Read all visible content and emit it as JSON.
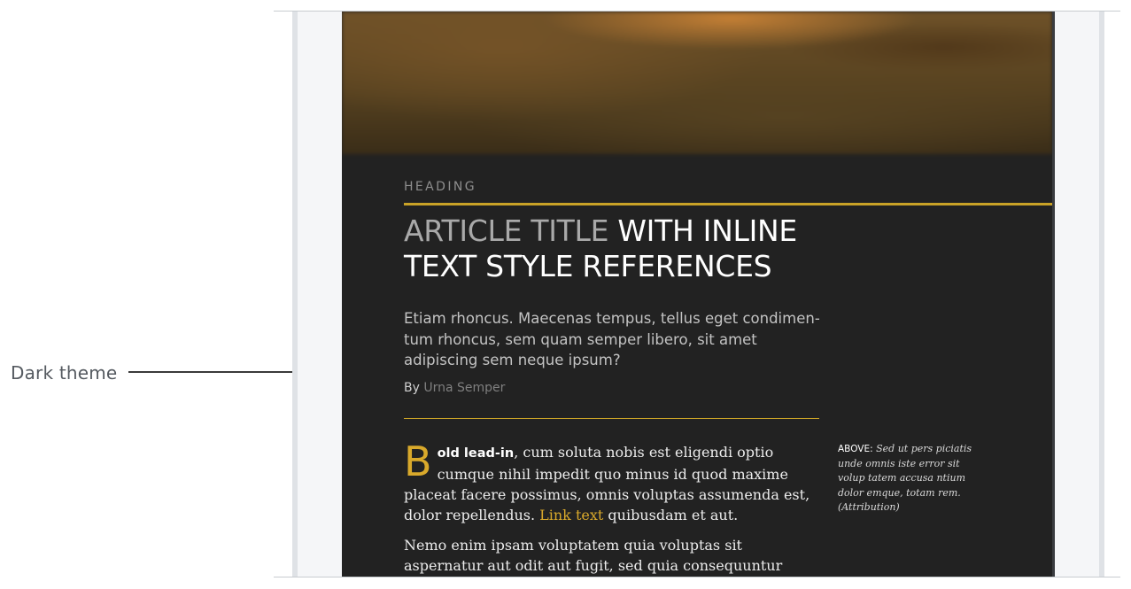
{
  "callout": {
    "label": "Dark theme"
  },
  "article": {
    "heading": "HEADING",
    "title_dim": "ARTICLE TITLE",
    "title_rest": " WITH INLINE TEXT STYLE REFERENCES",
    "deck": "Etiam rhoncus. Maecenas tempus, tellus eget condimen-tum rhoncus, sem quam semper libero, sit amet adipiscing sem neque ipsum?",
    "byline_prefix": "By ",
    "author": "Urna Semper",
    "dropcap": "B",
    "lead_in": "old lead-in",
    "para1_rest": ", cum soluta nobis est eligendi optio cumque nihil impedit quo minus id quod maxime placeat facere possimus, omnis voluptas assumenda est, dolor repellendus. ",
    "link_text": "Link text",
    "para1_end": " quibusdam et aut.",
    "para2": "Nemo enim ipsam voluptatem quia voluptas sit aspernatur aut odit aut fugit, sed quia consequuntur magni dolores eos qui ra-",
    "caption_label": "ABOVE:",
    "caption_text": " Sed ut pers piciatis unde omnis iste error sit volup tatem accusa ntium dolor emque, totam rem. (Attribution)"
  },
  "colors": {
    "accent_gold": "#c9a227",
    "background_dark": "#222222"
  }
}
